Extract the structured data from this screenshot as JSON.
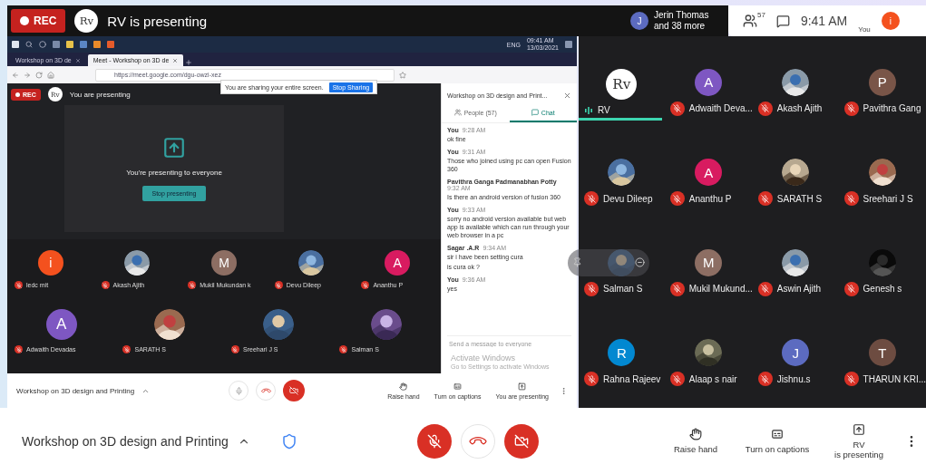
{
  "top_bar": {
    "rec": "REC",
    "logo": "Rv",
    "title": "RV is presenting"
  },
  "header_right": {
    "others_initial": "J",
    "others_line1": "Jerin Thomas",
    "others_line2": "and 38 more",
    "people_count": "57",
    "time": "9:41 AM",
    "you_label": "You",
    "you_initial": "i"
  },
  "shared_screen": {
    "taskbar": {
      "language": "ENG",
      "time": "09:41 AM",
      "date": "13/03/2021"
    },
    "tabs": [
      {
        "label": "Workshop on 3D de",
        "selected": false
      },
      {
        "label": "Meet - Workshop on 3D de",
        "selected": true
      }
    ],
    "url": "https://meet.google.com/dgu-owzi-xez",
    "sharing_notice": {
      "text": "You are sharing your entire screen.",
      "button": "Stop Sharing"
    },
    "meet": {
      "rec": "REC",
      "logo": "Rv",
      "title": "You are presenting",
      "card_text": "You're presenting to everyone",
      "card_button": "Stop presenting",
      "tiles": [
        {
          "name": "ledc mit",
          "avatar": {
            "kind": "letter",
            "letter": "i",
            "color": "#f4511e"
          }
        },
        {
          "name": "Akash Ajith"
        },
        {
          "name": "Mukil Mukundan k",
          "avatar": {
            "kind": "letter",
            "letter": "M",
            "color": "#8d6e63"
          }
        },
        {
          "name": "Devu Dileep"
        },
        {
          "name": "Ananthu P",
          "avatar": {
            "kind": "letter",
            "letter": "A",
            "color": "#d81b60"
          }
        },
        {
          "name": "Adwaith Devadas",
          "avatar": {
            "kind": "letter",
            "letter": "A",
            "color": "#7e57c2"
          }
        },
        {
          "name": "SARATH S"
        },
        {
          "name": "Sreehari J S"
        },
        {
          "name": "Salman S"
        }
      ],
      "chat": {
        "title": "Workshop on 3D design and Print...",
        "tabs": [
          {
            "label": "People (57)",
            "selected": false
          },
          {
            "label": "Chat",
            "selected": true
          }
        ],
        "messages": [
          {
            "sender": "You",
            "time": "9:28 AM",
            "lines": [
              "ok fine"
            ]
          },
          {
            "sender": "You",
            "time": "9:31 AM",
            "lines": [
              "Those who joined using pc can open Fusion 360"
            ]
          },
          {
            "sender": "Pavithra Ganga Padmanabhan Potty",
            "time": "9:32 AM",
            "lines": [
              "Is there an android version of fusion 360"
            ]
          },
          {
            "sender": "You",
            "time": "9:33 AM",
            "lines": [
              "sorry no android version available but web app is available which can run through your web browser in a pc"
            ]
          },
          {
            "sender": "Sagar .A.R",
            "time": "9:34 AM",
            "lines": [
              "sir i have been setting cura",
              "is cura ok ?"
            ]
          },
          {
            "sender": "You",
            "time": "9:36 AM",
            "lines": [
              "yes"
            ]
          }
        ],
        "placeholder": "Send a message to everyone"
      },
      "bottom": {
        "title": "Workshop on 3D design and Printing",
        "muted": false,
        "camera_on": false,
        "actions": [
          "Raise hand",
          "Turn on captions",
          "You are presenting"
        ]
      },
      "watermark": {
        "line1": "Activate Windows",
        "line2": "Go to Settings to activate Windows"
      }
    }
  },
  "grid": [
    {
      "name": "RV",
      "muted": false,
      "speaking": true,
      "hovered": false,
      "avatar": {
        "kind": "logo",
        "letter": "Rv"
      }
    },
    {
      "name": "Adwaith Deva...",
      "muted": true,
      "speaking": false,
      "hovered": false,
      "avatar": {
        "kind": "letter",
        "letter": "A",
        "color": "#7e57c2"
      }
    },
    {
      "name": "Akash Ajith",
      "muted": true,
      "speaking": false,
      "hovered": false
    },
    {
      "name": "Pavithra Gang",
      "muted": true,
      "speaking": false,
      "hovered": false,
      "avatar": {
        "kind": "letter",
        "letter": "P",
        "color": "#795548"
      }
    },
    {
      "name": "Devu Dileep",
      "muted": true,
      "speaking": false,
      "hovered": false
    },
    {
      "name": "Ananthu P",
      "muted": true,
      "speaking": false,
      "hovered": false,
      "avatar": {
        "kind": "letter",
        "letter": "A",
        "color": "#d81b60"
      }
    },
    {
      "name": "SARATH S",
      "muted": true,
      "speaking": false,
      "hovered": false
    },
    {
      "name": "Sreehari J S",
      "muted": true,
      "speaking": false,
      "hovered": false
    },
    {
      "name": "Salman S",
      "muted": true,
      "speaking": false,
      "hovered": true
    },
    {
      "name": "Mukil Mukund...",
      "muted": true,
      "speaking": false,
      "hovered": false,
      "avatar": {
        "kind": "letter",
        "letter": "M",
        "color": "#8d6e63"
      }
    },
    {
      "name": "Aswin Ajith",
      "muted": true,
      "speaking": false,
      "hovered": false
    },
    {
      "name": "Genesh s",
      "muted": true,
      "speaking": false,
      "hovered": false
    },
    {
      "name": "Rahna Rajeev",
      "muted": true,
      "speaking": false,
      "hovered": false,
      "avatar": {
        "kind": "letter",
        "letter": "R",
        "color": "#0288d1"
      }
    },
    {
      "name": "Alaap s nair",
      "muted": true,
      "speaking": false,
      "hovered": false
    },
    {
      "name": "Jishnu.s",
      "muted": true,
      "speaking": false,
      "hovered": false,
      "avatar": {
        "kind": "letter",
        "letter": "J",
        "color": "#5c6bc0"
      }
    },
    {
      "name": "THARUN KRI...",
      "muted": true,
      "speaking": false,
      "hovered": false,
      "avatar": {
        "kind": "letter",
        "letter": "T",
        "color": "#6d4c41"
      }
    }
  ],
  "bottom_bar": {
    "title": "Workshop on 3D design and Printing",
    "muted": true,
    "camera_on": false,
    "actions": [
      {
        "kind": "hand",
        "lines": [
          "Raise hand"
        ]
      },
      {
        "kind": "captions",
        "lines": [
          "Turn on captions"
        ]
      },
      {
        "kind": "present",
        "lines": [
          "RV",
          "is presenting"
        ]
      }
    ]
  }
}
